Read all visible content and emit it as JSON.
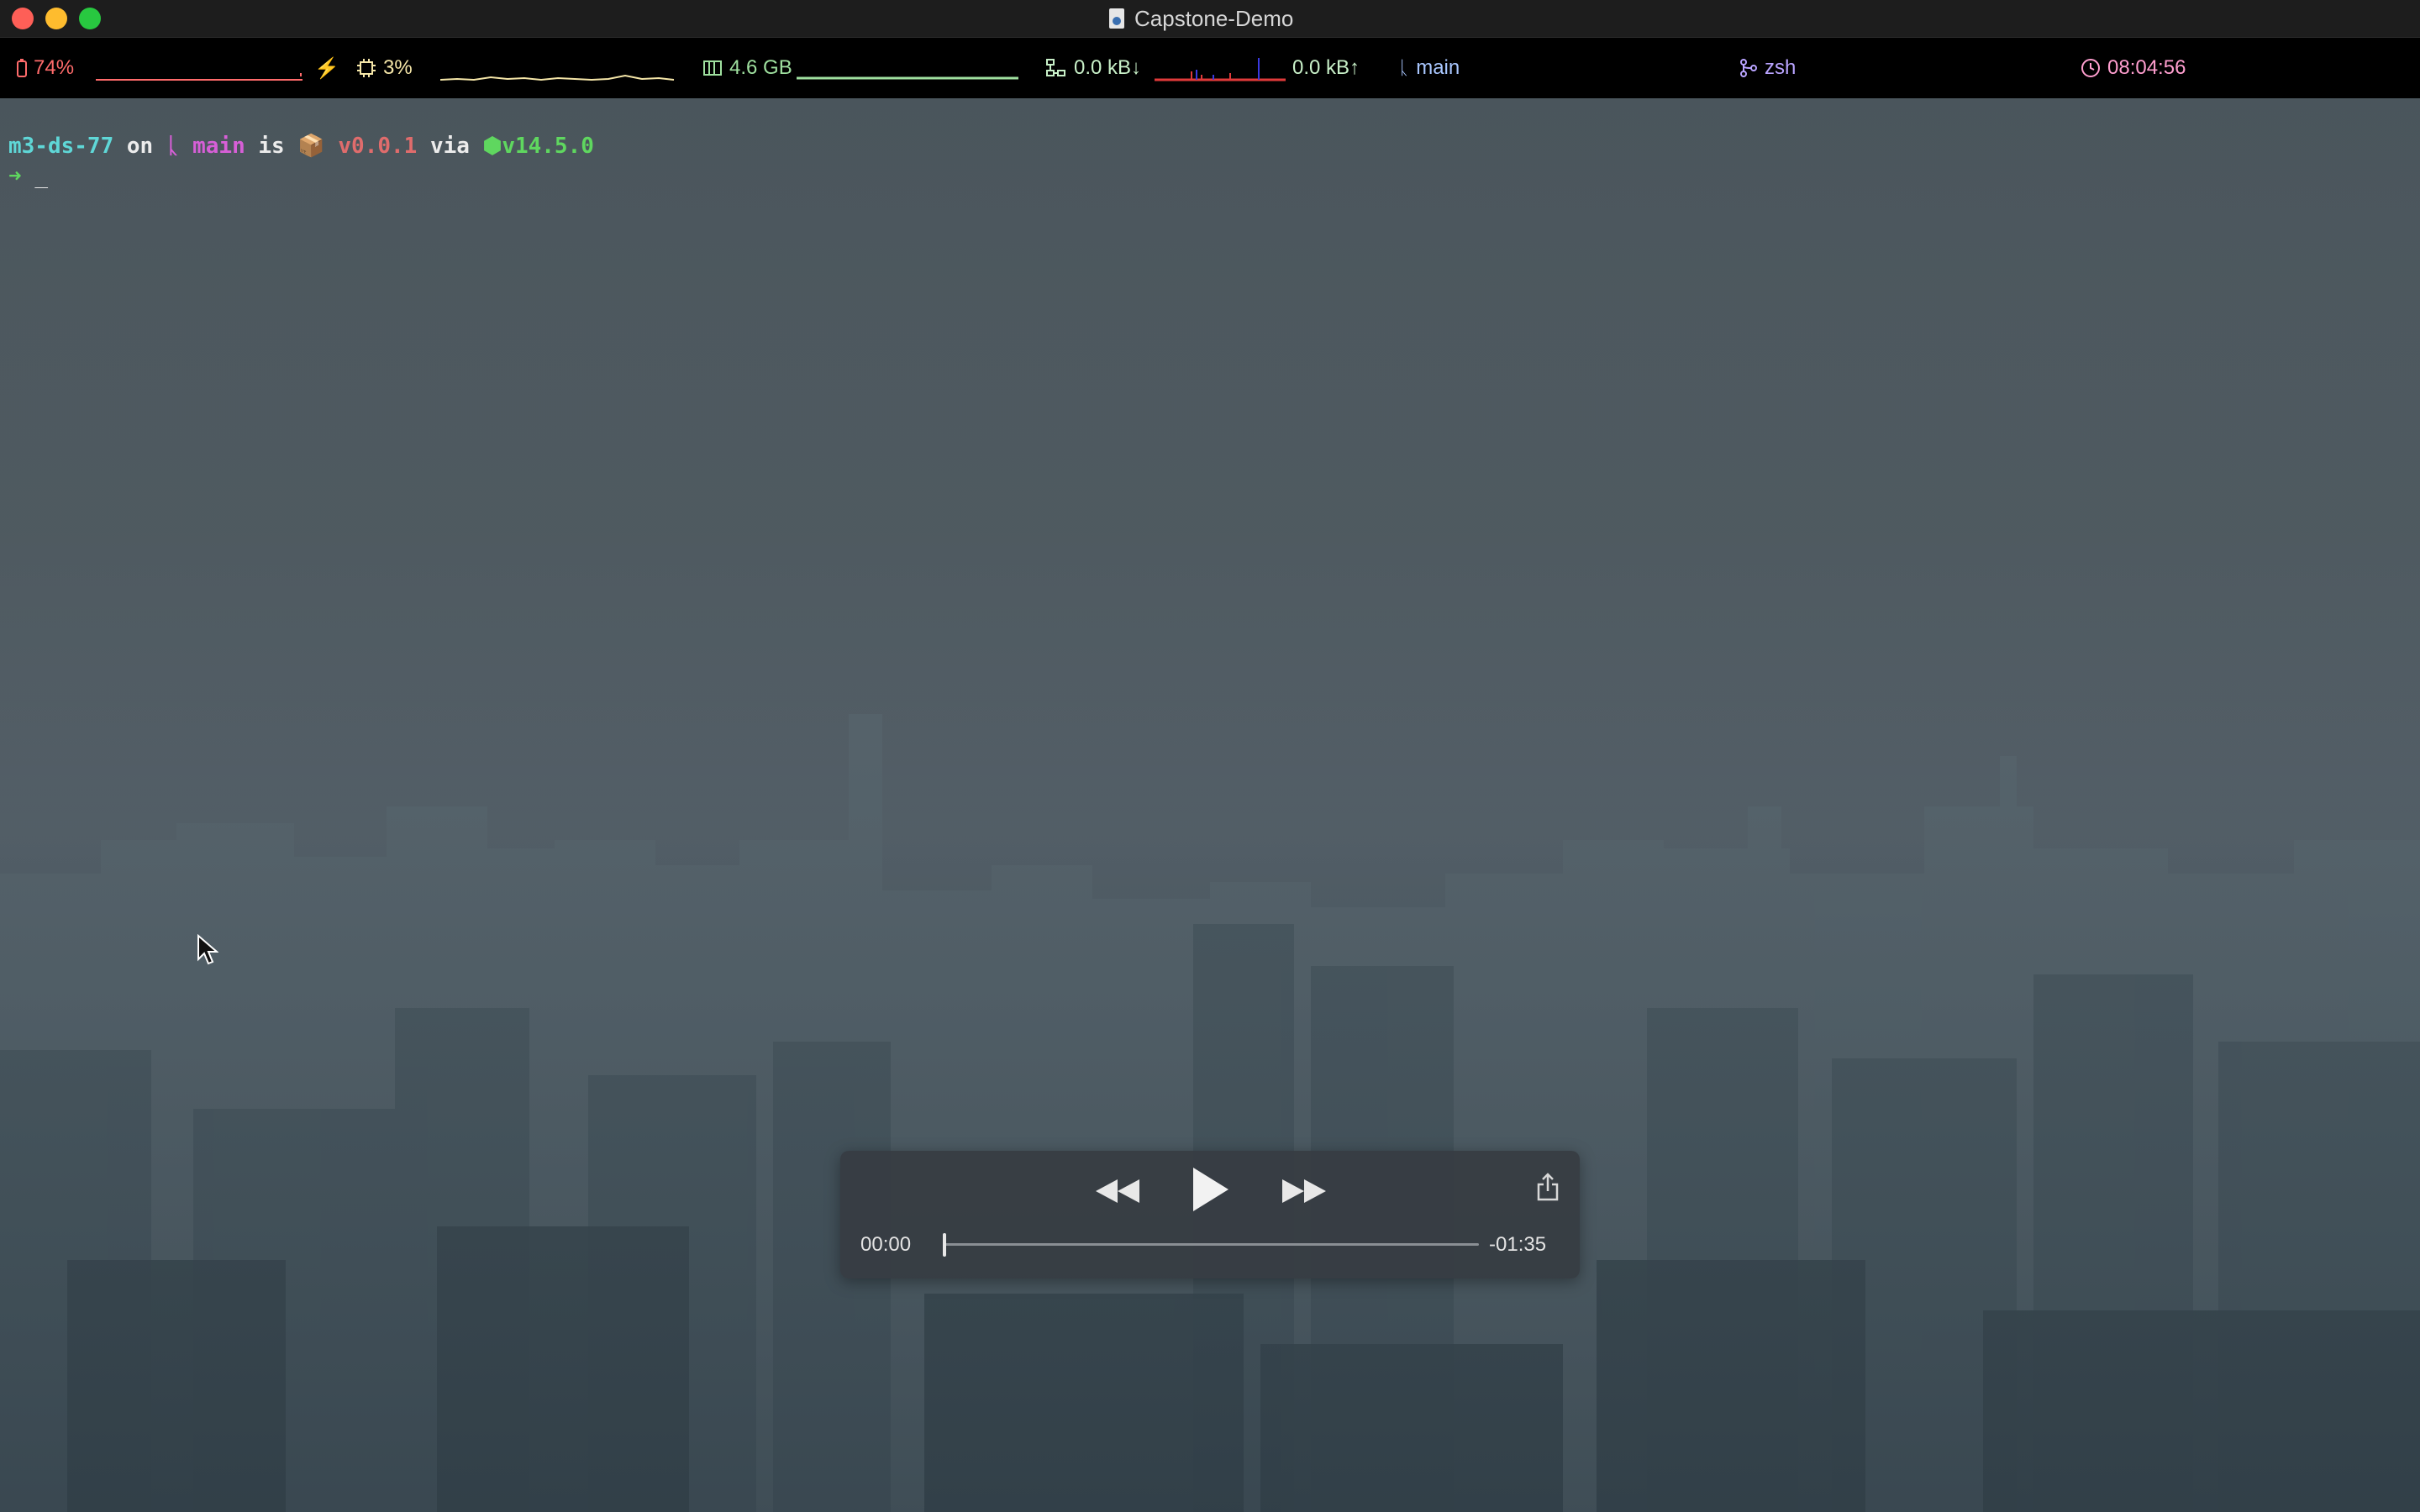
{
  "window": {
    "title": "Capstone-Demo"
  },
  "statusbar": {
    "battery": "74%",
    "cpu": "3%",
    "memory": "4.6 GB",
    "net_down": "0.0 kB↓",
    "net_up": "0.0 kB↑",
    "branch": "main",
    "shell": "zsh",
    "clock": "08:04:56"
  },
  "terminal": {
    "dir": "m3-ds-77",
    "on": " on ",
    "branch_icon": "ᚳ",
    "branch": "main",
    "is": " is ",
    "package_version": "v0.0.1",
    "via": " via ",
    "node_version": "v14.5.0",
    "prompt_arrow": "➜",
    "cursor": "_"
  },
  "player": {
    "elapsed": "00:00",
    "remaining": "-01:35",
    "progress": 0
  },
  "icons": {
    "battery": "battery-icon",
    "cpu": "cpu-icon",
    "memory": "memory-icon",
    "network": "network-icon",
    "branch": "git-branch-icon",
    "shell": "shell-icon",
    "clock": "clock-icon"
  },
  "colors": {
    "battery": "#ff6b6b",
    "cpu": "#f5e6a8",
    "memory": "#9fe09f",
    "network": "#c8f0c8",
    "branch": "#a9c7ff",
    "shell": "#b9a4ff",
    "clock": "#ff9ecf"
  }
}
